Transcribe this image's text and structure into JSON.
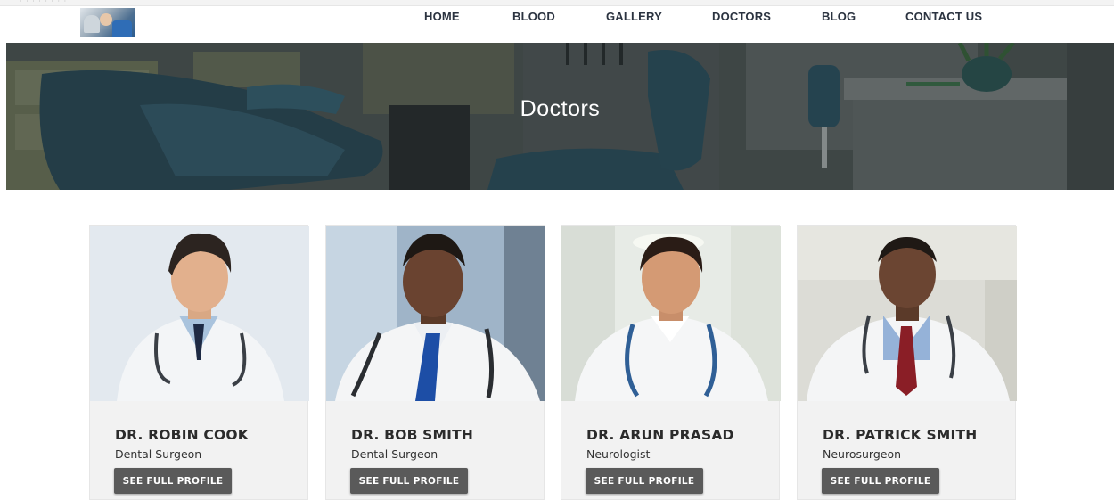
{
  "nav": {
    "items": [
      {
        "label": "HOME"
      },
      {
        "label": "BLOOD"
      },
      {
        "label": "GALLERY"
      },
      {
        "label": "DOCTORS"
      },
      {
        "label": "BLOG"
      },
      {
        "label": "CONTACT US"
      }
    ]
  },
  "hero": {
    "title": "Doctors"
  },
  "doctors": [
    {
      "name": "DR. ROBIN COOK",
      "role": "Dental Surgeon",
      "button": "SEE FULL PROFILE"
    },
    {
      "name": "DR. BOB SMITH",
      "role": "Dental Surgeon",
      "button": "SEE FULL PROFILE"
    },
    {
      "name": "DR. ARUN PRASAD",
      "role": "Neurologist",
      "button": "SEE FULL PROFILE"
    },
    {
      "name": "DR. PATRICK SMITH",
      "role": "Neurosurgeon",
      "button": "SEE FULL PROFILE"
    }
  ],
  "colors": {
    "nav_text": "#2b3340",
    "card_bg": "#f2f2f2",
    "button_bg": "#5a5a5a",
    "hero_text": "#ffffff"
  }
}
